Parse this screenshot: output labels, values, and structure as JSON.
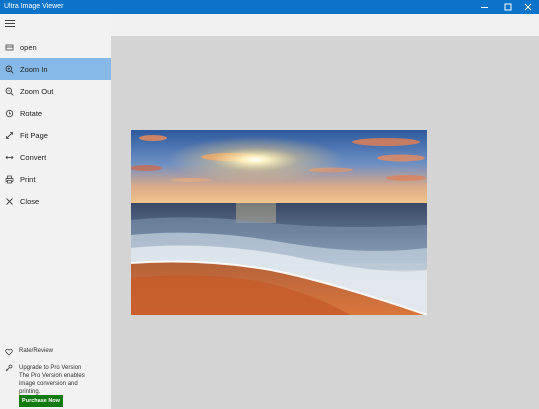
{
  "window": {
    "title": "Ultra Image Viewer",
    "controls": [
      "minimize-icon",
      "maximize-icon",
      "close-icon"
    ]
  },
  "sidebar": {
    "menu_icon": "hamburger-icon",
    "items": [
      {
        "label": "open",
        "icon": "open-icon",
        "active": false
      },
      {
        "label": "Zoom In",
        "icon": "zoom-in-icon",
        "active": true
      },
      {
        "label": "Zoom Out",
        "icon": "zoom-out-icon",
        "active": false
      },
      {
        "label": "Rotate",
        "icon": "rotate-icon",
        "active": false
      },
      {
        "label": "Fit Page",
        "icon": "fit-page-icon",
        "active": false
      },
      {
        "label": "Convert",
        "icon": "convert-icon",
        "active": false
      },
      {
        "label": "Print",
        "icon": "print-icon",
        "active": false
      },
      {
        "label": "Close",
        "icon": "close-icon",
        "active": false
      }
    ],
    "rate": {
      "label": "Rate/Review",
      "icon": "heart-icon"
    },
    "upgrade": {
      "title": "Upgrade to Pro Version",
      "description": "The Pro Version enables image conversion and printing.",
      "icon": "upgrade-icon"
    },
    "purchase_label": "Purchase Now"
  },
  "colors": {
    "titlebar": "#0b73c9",
    "active_item": "#86b9e8",
    "purchase_button": "#107c10",
    "viewer_background": "#d4d4d4"
  }
}
